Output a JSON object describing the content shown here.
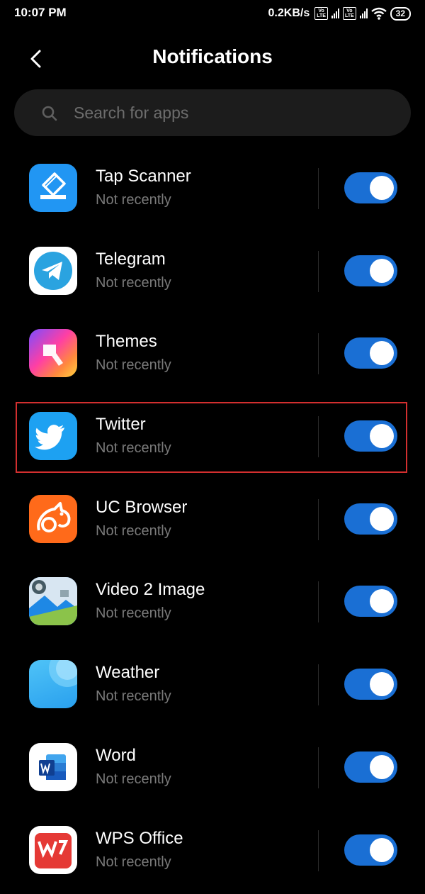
{
  "status_bar": {
    "time": "10:07 PM",
    "net_speed": "0.2KB/s",
    "volte_label": "Vo\nLTE",
    "battery": "32"
  },
  "header": {
    "title": "Notifications"
  },
  "search": {
    "placeholder": "Search for apps"
  },
  "apps": [
    {
      "name": "Tap Scanner",
      "status": "Not recently",
      "enabled": true,
      "icon": "tap-scanner-icon"
    },
    {
      "name": "Telegram",
      "status": "Not recently",
      "enabled": true,
      "icon": "telegram-icon"
    },
    {
      "name": "Themes",
      "status": "Not recently",
      "enabled": true,
      "icon": "themes-icon"
    },
    {
      "name": "Twitter",
      "status": "Not recently",
      "enabled": true,
      "icon": "twitter-icon",
      "highlighted": true
    },
    {
      "name": "UC Browser",
      "status": "Not recently",
      "enabled": true,
      "icon": "uc-browser-icon"
    },
    {
      "name": "Video 2 Image",
      "status": "Not recently",
      "enabled": true,
      "icon": "video-2-image-icon"
    },
    {
      "name": "Weather",
      "status": "Not recently",
      "enabled": true,
      "icon": "weather-icon"
    },
    {
      "name": "Word",
      "status": "Not recently",
      "enabled": true,
      "icon": "word-icon"
    },
    {
      "name": "WPS Office",
      "status": "Not recently",
      "enabled": true,
      "icon": "wps-office-icon"
    }
  ],
  "colors": {
    "background": "#000000",
    "toggle_on": "#1a6fd4",
    "highlight_border": "#d32f2f",
    "subtext": "#7a7a7a"
  }
}
